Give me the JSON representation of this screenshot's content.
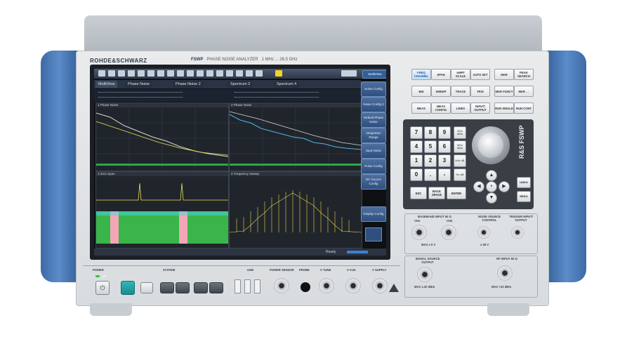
{
  "brand": "ROHDE&SCHWARZ",
  "model": {
    "name": "FSWP",
    "description": "PHASE NOISE ANALYZER",
    "range": "1 MHz ... 26.5 GHz"
  },
  "screen": {
    "tabs": [
      "MultiView",
      "Phase Noise",
      "Phase Noise 2",
      "Spectrum 2",
      "Spectrum 4"
    ],
    "softkeys": [
      "Noise Config",
      "Noise Config 2",
      "Default Phase Noise",
      "Integration Range",
      "Spot Noise",
      "Pulse Config",
      "DC Source Config",
      "Display Config"
    ],
    "top_right_button": "MultiView",
    "status": "Ready",
    "plots": [
      {
        "title": "1 Phase Noise"
      },
      {
        "title": "2 Phase Noise"
      },
      {
        "title": "3 Zero Span"
      },
      {
        "title": "4 Frequency Sweep"
      }
    ]
  },
  "keys": {
    "row1": [
      "FREQ CHANNEL",
      "SPAN",
      "AMPT SCALE",
      "AUTO SET",
      "MKR",
      "PEAK SEARCH"
    ],
    "row2": [
      "BW",
      "SWEEP",
      "TRACE",
      "TRIG",
      "MKR FUNCT",
      "MKR →"
    ],
    "row3": [
      "MEAS",
      "MEAS CONFIG",
      "LINES",
      "INPUT/ OUTPUT",
      "RUN SINGLE",
      "RUN CONT"
    ],
    "numpad": [
      "7",
      "8",
      "9",
      "4",
      "5",
      "6",
      "1",
      "2",
      "3",
      "0",
      ".",
      "-"
    ],
    "units": [
      "GHz dBm",
      "MHz dBm",
      "kHz dB",
      "Hz dB"
    ],
    "bottom": [
      "ESC",
      "BACK SPACE",
      "ENTER"
    ],
    "side": [
      "UNDO",
      "REDO"
    ],
    "vertical_model": "R&S FSWP"
  },
  "connectors": {
    "baseband": {
      "label": "BASEBAND INPUT 50 Ω",
      "sub": [
        "CH1",
        "CH2"
      ],
      "note": "MAX ± 5 V"
    },
    "noise_source": {
      "label": "NOISE SOURCE CONTROL",
      "note": "± 28 V"
    },
    "trigger": {
      "label": "TRIGGER INPUT/ OUTPUT",
      "note": ""
    },
    "signal_source": {
      "label": "SIGNAL SOURCE OUTPUT",
      "note": "MAX 1.20 dBm"
    },
    "rf_input": {
      "label": "RF INPUT 50 Ω",
      "note": "MAX +23 dBm"
    }
  },
  "bottom_panel": {
    "power": "POWER",
    "system": "SYSTEM",
    "usb": "USB",
    "power_sensor": "POWER SENSOR",
    "probe": "PROBE",
    "v_tune": "V TUNE",
    "v_aux": "V AUX",
    "v_supply": "V SUPPLY"
  }
}
